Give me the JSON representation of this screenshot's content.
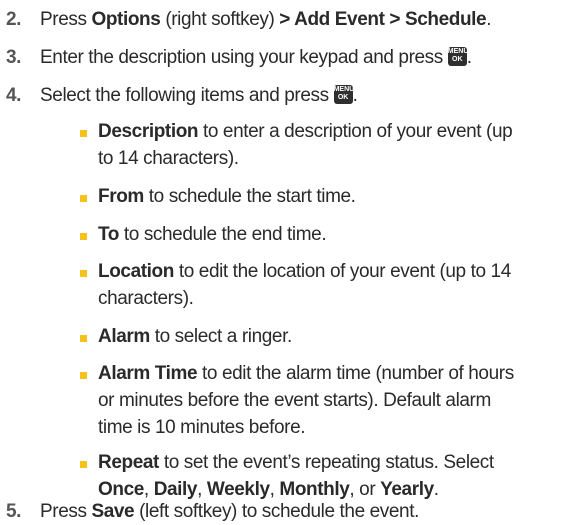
{
  "steps": [
    {
      "num": "2.",
      "p1": "Press ",
      "b1": "Options",
      "p2": " (right softkey) ",
      "b2": "> Add Event > Schedule",
      "p3": "."
    },
    {
      "num": "3.",
      "p1": "Enter the description using your keypad and press ",
      "icon": "menu-ok-key-icon",
      "p2": "."
    },
    {
      "num": "4.",
      "p1": "Select the following items and press ",
      "icon": "menu-ok-key-icon",
      "p2": "."
    },
    {
      "num": "5.",
      "p1": "Press ",
      "b1": "Save",
      "p2": " (left softkey) to schedule the event."
    }
  ],
  "menu_ok_icon": {
    "line1": "MENU",
    "line2": "OK"
  },
  "bullets": [
    {
      "term": "Description",
      "line1": " to enter a description of your event (up",
      "line2": "to 14 characters)."
    },
    {
      "term": "From",
      "line1": " to schedule the start time."
    },
    {
      "term": "To",
      "line1": " to schedule the end time."
    },
    {
      "term": "Location",
      "line1": " to edit the location of your event (up to 14",
      "line2": "characters)."
    },
    {
      "term": "Alarm",
      "line1": " to select a ringer."
    },
    {
      "term": "Alarm Time",
      "line1": " to edit the alarm time (number of hours",
      "line2": "or minutes before the event starts). Default alarm",
      "line3": "time is 10 minutes before."
    },
    {
      "term": "Repeat",
      "line1": " to set the event’s repeating status. Select",
      "opt1": "Once",
      "sep1": ", ",
      "opt2": "Daily",
      "sep2": ", ",
      "opt3": "Weekly",
      "sep3": ", ",
      "opt4": "Monthly",
      "sep4": ", or ",
      "opt5": "Yearly",
      "end": "."
    }
  ],
  "colors": {
    "bullet": "#f5c21b",
    "step_number": "#555555",
    "text": "#2a2a2a"
  }
}
